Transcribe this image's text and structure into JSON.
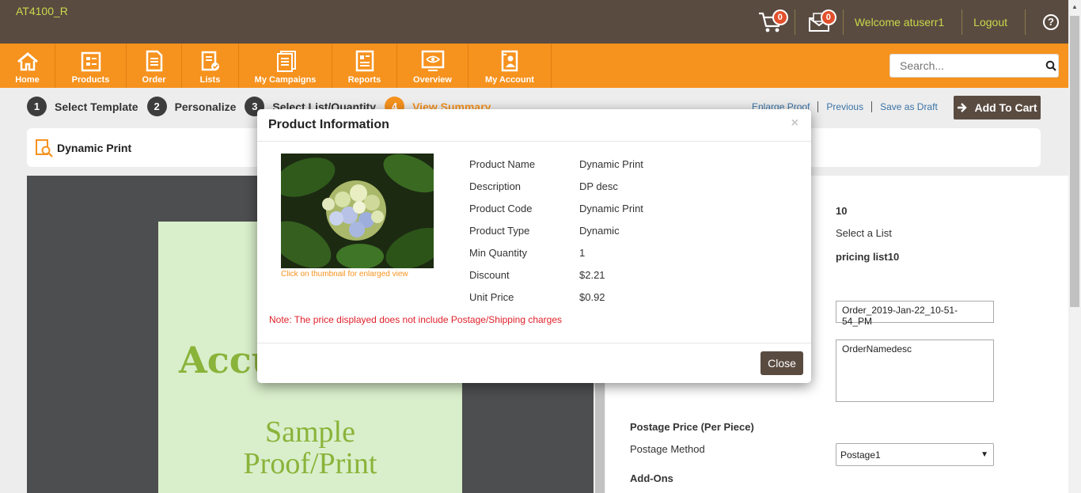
{
  "header": {
    "app_code": "AT4100_R",
    "cart_count": "0",
    "messages_count": "0",
    "welcome": "Welcome atuserr1",
    "logout": "Logout",
    "help": "?"
  },
  "nav": {
    "items": [
      {
        "label": "Home",
        "icon": "home-icon"
      },
      {
        "label": "Products",
        "icon": "products-icon"
      },
      {
        "label": "Order",
        "icon": "order-icon"
      },
      {
        "label": "Lists",
        "icon": "lists-icon"
      },
      {
        "label": "My Campaigns",
        "icon": "campaigns-icon"
      },
      {
        "label": "Reports",
        "icon": "reports-icon"
      },
      {
        "label": "Overview",
        "icon": "overview-icon"
      },
      {
        "label": "My Account",
        "icon": "account-icon"
      }
    ],
    "search_placeholder": "Search..."
  },
  "steps": [
    {
      "num": "1",
      "label": "Select Template"
    },
    {
      "num": "2",
      "label": "Personalize"
    },
    {
      "num": "3",
      "label": "Select List/Quantity"
    },
    {
      "num": "4",
      "label": "View Summary"
    }
  ],
  "step_links": {
    "enlarge": "Enlarge Proof",
    "previous": "Previous",
    "draft": "Save as Draft",
    "add_to_cart": "Add To Cart"
  },
  "product": {
    "title": "Dynamic Print"
  },
  "proof": {
    "heading": "Accu",
    "line1": "Sample",
    "line2": "Proof/Print"
  },
  "form": {
    "quantity": "10",
    "list_label": "Select a List",
    "list_value": "pricing list10",
    "order_name": "Order_2019-Jan-22_10-51-54_PM",
    "order_desc": "OrderNamedesc",
    "postage_heading": "Postage Price (Per Piece)",
    "postage_method_label": "Postage Method",
    "postage_method_value": "Postage1",
    "addons_heading": "Add-Ons"
  },
  "modal": {
    "title": "Product Information",
    "close_x": "×",
    "thumb_caption": "Click on thumbnail for enlarged view",
    "rows": [
      {
        "label": "Product Name",
        "value": "Dynamic Print"
      },
      {
        "label": "Description",
        "value": "DP desc"
      },
      {
        "label": "Product Code",
        "value": "Dynamic Print"
      },
      {
        "label": "Product Type",
        "value": "Dynamic"
      },
      {
        "label": "Min Quantity",
        "value": "1"
      },
      {
        "label": "Discount",
        "value": "$2.21"
      },
      {
        "label": "Unit Price",
        "value": "$0.92"
      }
    ],
    "note": "Note: The price displayed does not include Postage/Shipping charges",
    "close_button": "Close"
  },
  "colors": {
    "topbar": "#5a4b41",
    "nav": "#f6921e",
    "accent_green": "#8ab33a",
    "note_red": "#e0202a"
  }
}
